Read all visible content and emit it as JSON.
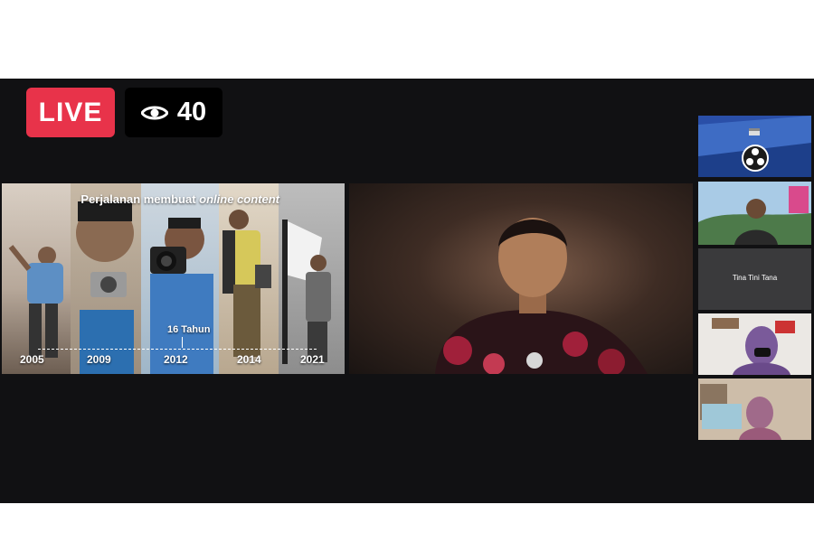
{
  "stream": {
    "live_label": "LIVE",
    "viewer_count": "40",
    "viewer_icon": "eye-icon"
  },
  "share_panel": {
    "title_plain": "Perjalanan membuat ",
    "title_italic": "online content",
    "timeline_note": "16 Tahun",
    "years": [
      "2005",
      "2009",
      "2012",
      "2014",
      "2021"
    ]
  },
  "participants": [
    {
      "name": "",
      "icon": "obs-logo-icon"
    },
    {
      "name": ""
    },
    {
      "name": "Tina Tini Tana"
    },
    {
      "name": ""
    },
    {
      "name": ""
    }
  ],
  "colors": {
    "live": "#e8334a",
    "stage": "#111113",
    "thumb_blue": "#2a4fa8"
  }
}
